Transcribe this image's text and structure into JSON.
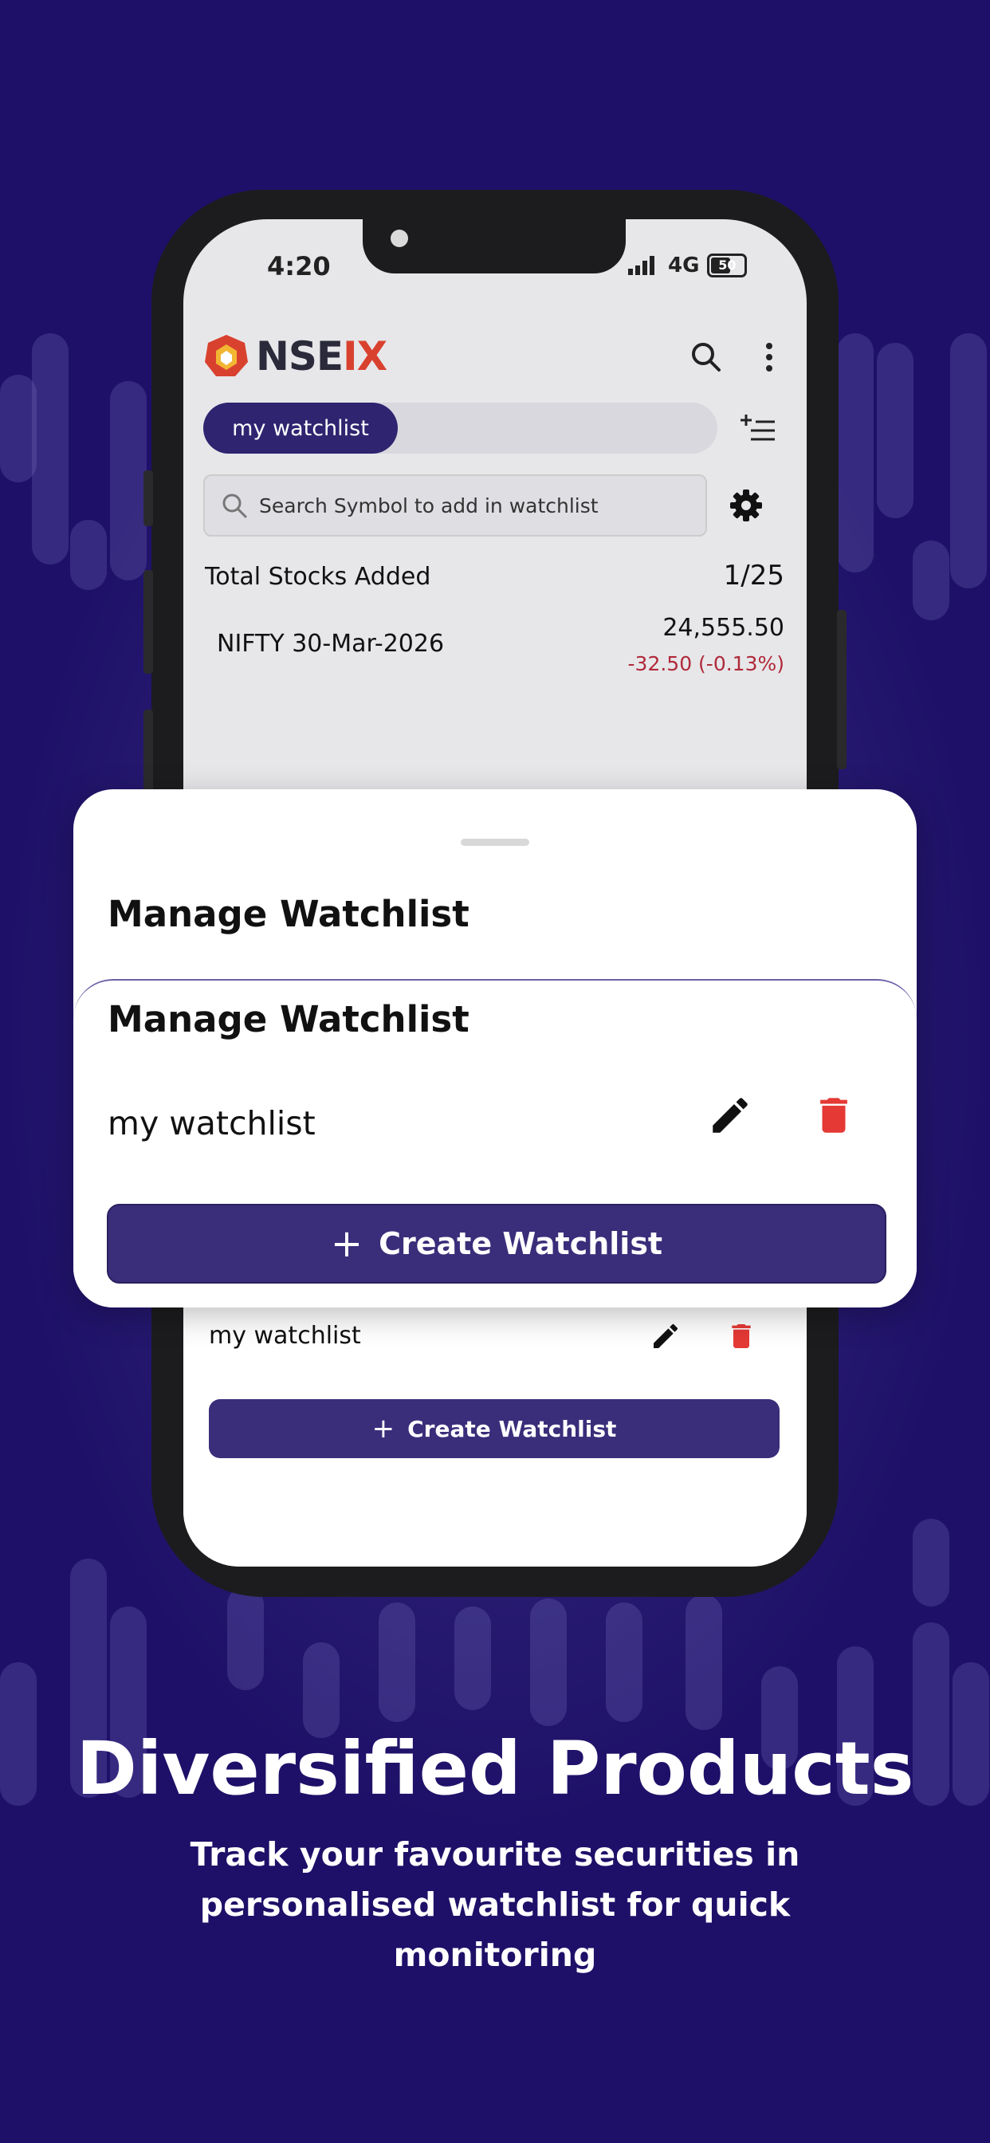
{
  "status_bar": {
    "time": "4:20",
    "network": "4G",
    "battery": "50"
  },
  "app": {
    "logo_text_a": "NSE",
    "logo_text_b": "IX",
    "tab_active": "my watchlist",
    "search_placeholder": "Search Symbol to add in watchlist",
    "total_label": "Total Stocks Added",
    "total_value": "1/25",
    "stock": {
      "name": "NIFTY 30-Mar-2026",
      "price": "24,555.50",
      "change": "-32.50 (-0.13%)"
    },
    "list_name": "my watchlist",
    "create_label": "Create Watchlist"
  },
  "sheet": {
    "title": "Manage Watchlist",
    "card_title": "Manage Watchlist",
    "list_name": "my watchlist",
    "create_label": "Create Watchlist"
  },
  "promo": {
    "headline": "Diversified Products",
    "subline": "Track your favourite securities in personalised watchlist for quick monitoring"
  },
  "colors": {
    "brand_primary": "#2e2470",
    "delete": "#e53935",
    "negative": "#b02a3a"
  }
}
